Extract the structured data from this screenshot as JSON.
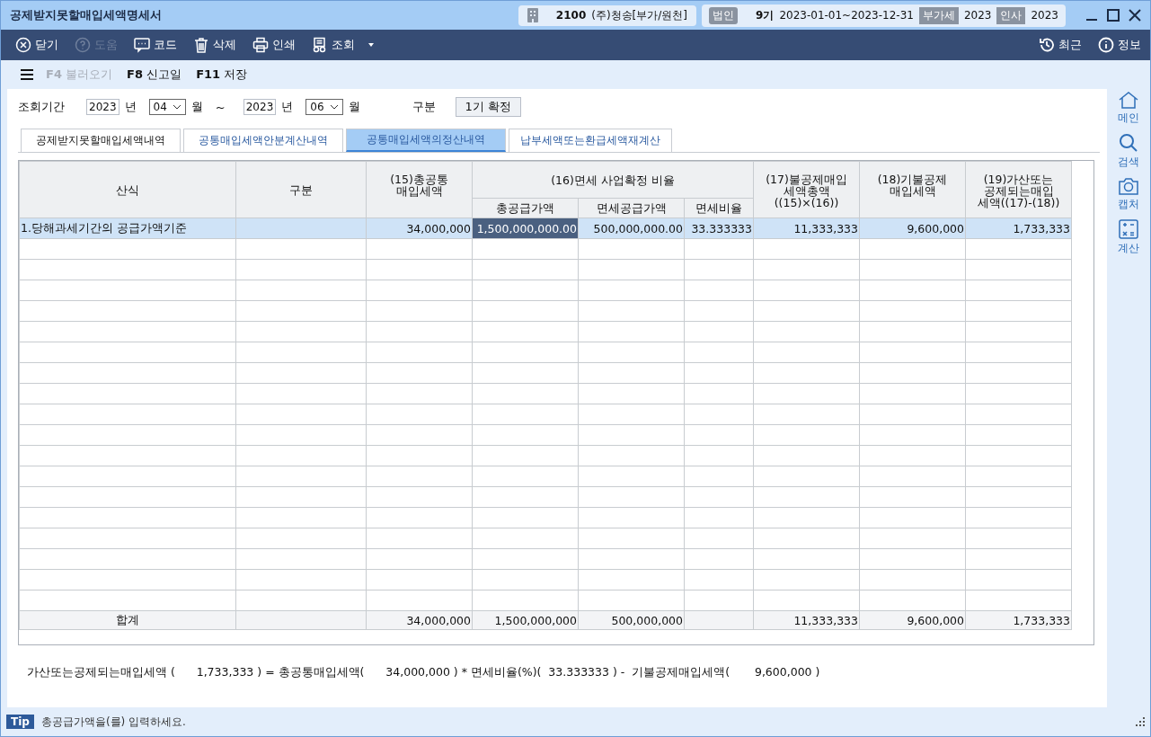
{
  "window": {
    "title": "공제받지못할매입세액명세서"
  },
  "company": {
    "code": "2100",
    "name": "(주)청송[부가/원천]"
  },
  "period": {
    "badge": "법인",
    "term": "9기",
    "range": "2023-01-01~2023-12-31",
    "vat_badge": "부가세",
    "vat_year": "2023",
    "hr_badge": "인사",
    "hr_year": "2023"
  },
  "toolbar": [
    {
      "label": "닫기",
      "disabled": false
    },
    {
      "label": "도움",
      "disabled": true
    },
    {
      "label": "코드",
      "disabled": false
    },
    {
      "label": "삭제",
      "disabled": false
    },
    {
      "label": "인쇄",
      "disabled": false
    },
    {
      "label": "조회",
      "disabled": false
    }
  ],
  "toolbar_right": [
    {
      "label": "최근"
    },
    {
      "label": "정보"
    }
  ],
  "fkeys": [
    {
      "key": "F4",
      "label": "불러오기",
      "disabled": true
    },
    {
      "key": "F8",
      "label": "신고일",
      "disabled": false
    },
    {
      "key": "F11",
      "label": "저장",
      "disabled": false
    }
  ],
  "filter": {
    "label": "조회기간",
    "from_year": "2023",
    "year_unit": "년",
    "from_month": "04",
    "month_unit": "월",
    "tilde": "~",
    "to_year": "2023",
    "to_year_unit": "년",
    "to_month": "06",
    "to_month_unit": "월",
    "type_label": "구분",
    "type_value": "1기 확정"
  },
  "tabs": [
    {
      "label": "공제받지못할매입세액내역",
      "selected": false
    },
    {
      "label": "공통매입세액안분계산내역",
      "selected": false
    },
    {
      "label": "공통매입세액의정산내역",
      "selected": true
    },
    {
      "label": "납부세액또는환급세액재계산",
      "selected": false
    }
  ],
  "table": {
    "columns": [
      "산식",
      "구분",
      "(15)총공통\n매입세액",
      "총공급가액",
      "면세공급가액",
      "면세비율",
      "(17)불공제매입\n세액총액\n((15)×(16))",
      "(18)기불공제\n매입세액",
      "(19)가산또는\n공제되는매입\n세액((17)-(18))"
    ],
    "group_header": "(16)면세 사업확정 비율",
    "rows": [
      {
        "selected": true,
        "cells": [
          {
            "text": "1.당해과세기간의 공급가액기준",
            "selected": false
          },
          {
            "selected": false
          },
          {
            "text": "34,000,000",
            "selected": false
          },
          {
            "text": "1,500,000,000.00",
            "selected": true
          },
          {
            "text": "500,000,000.00",
            "selected": false
          },
          {
            "text": "33.333333",
            "selected": false
          },
          {
            "text": "11,333,333",
            "selected": false
          },
          {
            "text": "9,600,000",
            "selected": false
          },
          {
            "text": "1,733,333",
            "selected": false
          }
        ]
      }
    ],
    "total": {
      "label": "합계",
      "common_tax": "34,000,000",
      "total_supply": "1,500,000,000",
      "exempt_supply": "500,000,000",
      "nondeductible": "11,333,333",
      "already_deducted": "9,600,000",
      "adjustment": "1,733,333"
    }
  },
  "formula": "가산또는공제되는매입세액 (      1,733,333 ) = 총공통매입세액(      34,000,000 ) * 면세비율(%)(  33.333333 ) -  기불공제매입세액(       9,600,000 )",
  "sidebar": [
    {
      "label": "메인"
    },
    {
      "label": "검색"
    },
    {
      "label": "캡처"
    },
    {
      "label": "계산"
    }
  ],
  "status": {
    "tip": "Tip",
    "message": "총공급가액을(를) 입력하세요."
  }
}
